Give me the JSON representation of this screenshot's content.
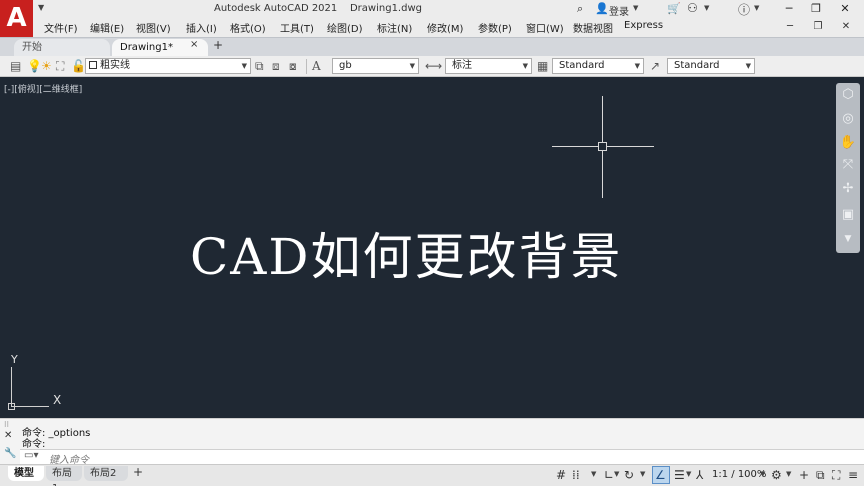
{
  "app": {
    "logo_letter": "A",
    "title": "Autodesk AutoCAD 2021    Drawing1.dwg",
    "login_label": "登录",
    "menus": [
      "文件(F)",
      "编辑(E)",
      "视图(V)",
      "插入(I)",
      "格式(O)",
      "工具(T)",
      "绘图(D)",
      "标注(N)",
      "修改(M)",
      "参数(P)",
      "窗口(W)",
      "数据视图",
      "Express"
    ]
  },
  "tabs": {
    "start_label": "开始",
    "drawing_label": "Drawing1*",
    "close_glyph": "×",
    "add_glyph": "+"
  },
  "toolbar": {
    "layer_value": "粗实线",
    "text_style_value": "gb",
    "dim_style_value": "标注",
    "table_style_value": "Standard",
    "mleader_style_value": "Standard"
  },
  "canvas": {
    "view_label": "[-][俯视][二维线框]",
    "headline": "CAD如何更改背景",
    "ucs_x": "X",
    "ucs_y": "Y"
  },
  "command": {
    "history": [
      "命令: _options",
      "命令:"
    ],
    "placeholder": "键入命令"
  },
  "statusbar": {
    "layout_tabs": [
      "模型",
      "布局1",
      "布局2"
    ],
    "add_glyph": "+",
    "annotation_scale": "1:1 / 100%"
  },
  "icons": [
    "search-icon",
    "user-icon",
    "cart-icon",
    "share-icon",
    "help-icon",
    "minimize-icon",
    "restore-icon",
    "close-icon",
    "layer-icon",
    "bulb-icon",
    "sun-icon",
    "lock-icon",
    "text-style-icon",
    "dim-style-icon",
    "table-style-icon",
    "mleader-style-icon",
    "viewcube-icon",
    "steering-wheel-icon",
    "pan-icon",
    "zoom-icon",
    "orbit-icon",
    "showmotion-icon",
    "grid-icon",
    "snap-icon",
    "polar-icon",
    "osnap-icon",
    "otrack-icon",
    "lineweight-icon",
    "annotation-icon",
    "gear-icon",
    "customize-icon"
  ]
}
